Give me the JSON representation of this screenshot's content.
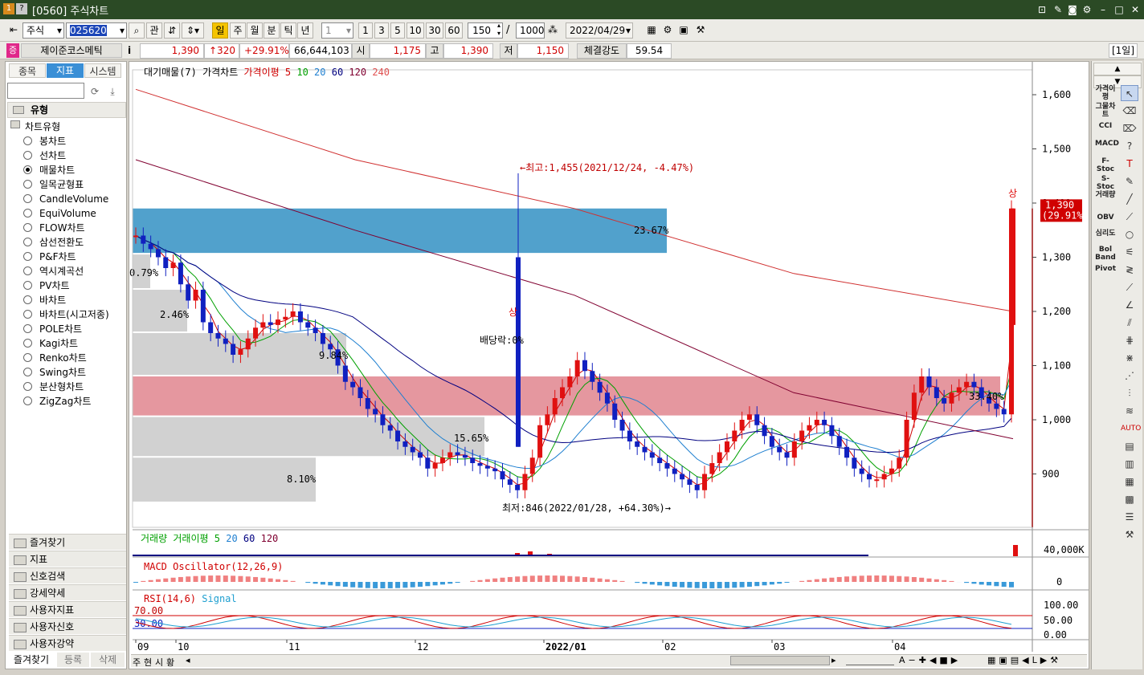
{
  "window": {
    "title": "[0560] 주식차트",
    "badges": [
      "1",
      "?"
    ]
  },
  "toolbar": {
    "market": "주식",
    "code": "025620",
    "inquiry": "관",
    "periods": [
      "일",
      "주",
      "월",
      "분",
      "틱",
      "년"
    ],
    "interval_select": "1",
    "minute_buttons": [
      "1",
      "3",
      "5",
      "10",
      "30",
      "60"
    ],
    "count": "150",
    "slash": "/",
    "max_count": "1000",
    "date": "2022/04/29"
  },
  "quote": {
    "badge": "증",
    "name": "제이준코스메틱",
    "info": "i",
    "price": "1,390",
    "change": "↑320",
    "change_pct": "+29.91%",
    "volume": "66,644,103",
    "open_label": "시",
    "open": "1,175",
    "high_label": "고",
    "high": "1,390",
    "low_label": "저",
    "low": "1,150",
    "strength_label": "체결강도",
    "strength": "59.54",
    "period_badge": "[1일]"
  },
  "left_panel": {
    "tabs": [
      "종목",
      "지표",
      "시스템"
    ],
    "section": "유형",
    "group": "차트유형",
    "chart_types": [
      "봉차트",
      "선차트",
      "매물차트",
      "일목균형표",
      "CandleVolume",
      "EquiVolume",
      "FLOW차트",
      "삼선전환도",
      "P&F차트",
      "역시계곡선",
      "PV차트",
      "바차트",
      "바차트(시고저종)",
      "POLE차트",
      "Kagi차트",
      "Renko차트",
      "Swing차트",
      "분산형차트",
      "ZigZag차트"
    ],
    "selected_index": 2,
    "folders": [
      "즐겨찾기",
      "지표",
      "신호검색",
      "강세약세",
      "사용자지표",
      "사용자신호",
      "사용자강약"
    ],
    "bottom_buttons": [
      "즐겨찾기",
      "등록",
      "삭제"
    ]
  },
  "chart": {
    "legend": [
      "대기매물(7)",
      "가격차트",
      "가격이평 5",
      "10",
      "20",
      "60",
      "120",
      "240"
    ],
    "legend_colors": [
      "#000000",
      "#000000",
      "#d00000",
      "#00a000",
      "#1e7fd0",
      "#000080",
      "#800030",
      "#e05050"
    ],
    "y_ticks": [
      "1,600",
      "1,500",
      "1,400",
      "1,300",
      "1,200",
      "1,100",
      "1,000",
      "900"
    ],
    "volume_profile_pct": [
      "23.67%",
      "0.79%",
      "2.46%",
      "9.84%",
      "15.65%",
      "8.10%",
      "33.40%"
    ],
    "annotations": {
      "high": "←최고:1,455(2021/12/24, -4.47%)",
      "low": "최저:846(2022/01/28, +64.30%)→",
      "dividend": "배당락:0%",
      "limit_up": "상",
      "last_price": "1,390",
      "last_pct": "(29.91%)"
    },
    "volume_legend": [
      "거래량",
      "거래이평 5",
      "20",
      "60",
      "120"
    ],
    "volume_axis": "40,000K",
    "macd_legend": "MACD Oscillator(12,26,9)",
    "macd_axis": "0",
    "rsi_legend": [
      "RSI(14,6)",
      "Signal"
    ],
    "rsi_levels": [
      "70.00",
      "30.00"
    ],
    "rsi_axis": [
      "100.00",
      "50.00",
      "0.00"
    ],
    "x_labels": [
      "09",
      "10",
      "11",
      "12",
      "2022/01",
      "02",
      "03",
      "04"
    ],
    "scroll_buttons": [
      "주",
      "현",
      "시",
      "황"
    ]
  },
  "right_toolbar": {
    "indicators": [
      "가격이평",
      "그물차트",
      "CCI",
      "MACD",
      "F-Stoc",
      "S-Stoc",
      "거래량",
      "OBV",
      "심리도",
      "Bol Band",
      "Pivot"
    ]
  },
  "chart_data": {
    "type": "candlestick",
    "title": "",
    "x_range": [
      "2021-09",
      "2022-04-29"
    ],
    "y_range": [
      846,
      1600
    ],
    "points": {
      "high": {
        "date": "2021/12/24",
        "value": 1455
      },
      "low": {
        "date": "2022/01/28",
        "value": 846
      },
      "last": {
        "date": "2022/04/29",
        "open": 1175,
        "high": 1390,
        "low": 1150,
        "close": 1390
      }
    },
    "series": [
      {
        "name": "가격차트",
        "values": [
          1340,
          1325,
          1315,
          1300,
          1280,
          1290,
          1250,
          1220,
          1240,
          1180,
          1160,
          1150,
          1140,
          1120,
          1130,
          1150,
          1170,
          1180,
          1175,
          1185,
          1190,
          1200,
          1180,
          1170,
          1160,
          1140,
          1130,
          1100,
          1070,
          1060,
          1040,
          1020,
          1010,
          990,
          980,
          960,
          950,
          940,
          930,
          910,
          920,
          930,
          940,
          935,
          930,
          920,
          915,
          910,
          905,
          890,
          880,
          870,
          900,
          930,
          990,
          1010,
          1040,
          1060,
          1080,
          1110,
          1090,
          1070,
          1050,
          1030,
          1000,
          980,
          960,
          950,
          940,
          930,
          920,
          910,
          900,
          890,
          880,
          870,
          900,
          920,
          940,
          960,
          980,
          1000,
          1010,
          990,
          970,
          950,
          940,
          930,
          960,
          980,
          990,
          1000,
          990,
          970,
          950,
          930,
          910,
          900,
          890,
          890,
          900,
          910,
          930,
          1000,
          1050,
          1080,
          1060,
          1040,
          1030,
          1050,
          1060,
          1070,
          1060,
          1040,
          1030,
          1020,
          1010,
          1390
        ]
      },
      {
        "name": "가격이평 240",
        "values": [
          1610,
          1480,
          1390,
          1270,
          1200
        ]
      },
      {
        "name": "가격이평 120",
        "values": [
          1480,
          1350,
          1230,
          1050,
          965
        ]
      }
    ],
    "volume_profile": [
      {
        "range": [
          1305,
          1390
        ],
        "pct": 23.67
      },
      {
        "range": [
          1240,
          1305
        ],
        "pct": 0.79
      },
      {
        "range": [
          1160,
          1240
        ],
        "pct": 2.46
      },
      {
        "range": [
          1080,
          1160
        ],
        "pct": 9.84
      },
      {
        "range": [
          1005,
          1080
        ],
        "pct": 33.4
      },
      {
        "range": [
          930,
          1005
        ],
        "pct": 15.65
      },
      {
        "range": [
          846,
          930
        ],
        "pct": 8.1
      }
    ]
  }
}
